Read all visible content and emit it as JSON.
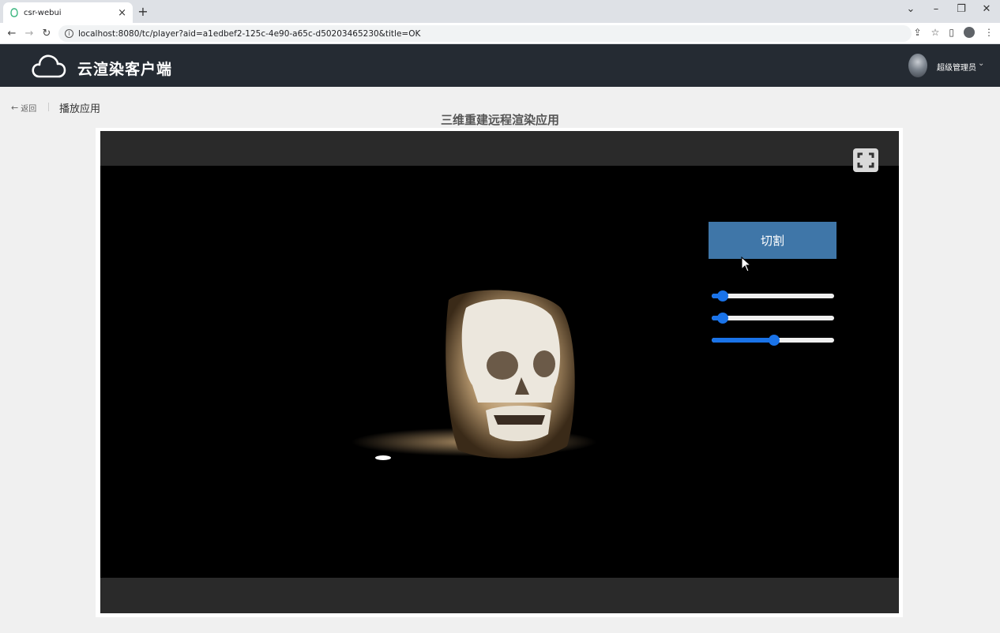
{
  "browser": {
    "tab_title": "csr-webui",
    "url": "localhost:8080/tc/player?aid=a1edbef2-125c-4e90-a65c-d50203465230&title=OK"
  },
  "header": {
    "app_title": "云渲染客户端",
    "user_name": "超级管理员"
  },
  "page": {
    "back_label": "返回",
    "breadcrumb_title": "播放应用",
    "player_title": "三维重建远程渲染应用"
  },
  "player": {
    "cut_button_label": "切割",
    "sliders": [
      {
        "value": 0.05
      },
      {
        "value": 0.05
      },
      {
        "value": 0.51
      }
    ]
  },
  "colors": {
    "header_bg": "#252b33",
    "cut_button_bg": "#3f76a8",
    "slider_accent": "#1a73e8"
  },
  "icons": {
    "logo": "cloud-icon",
    "fullscreen": "fullscreen-icon",
    "back": "arrow-left-icon"
  }
}
